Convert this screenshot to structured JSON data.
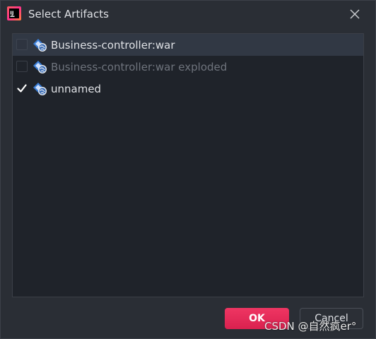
{
  "dialog": {
    "title": "Select Artifacts",
    "icon": "intellij-idea-icon",
    "close_icon": "close-icon"
  },
  "artifacts": [
    {
      "label": "Business-controller:war",
      "checked": false,
      "enabled": true,
      "selected": true,
      "icon": "web-artifact-icon"
    },
    {
      "label": "Business-controller:war exploded",
      "checked": false,
      "enabled": false,
      "selected": false,
      "icon": "web-artifact-icon"
    },
    {
      "label": "unnamed",
      "checked": true,
      "enabled": true,
      "selected": false,
      "icon": "web-artifact-icon"
    }
  ],
  "buttons": {
    "ok_label": "OK",
    "cancel_label": "Cancel"
  },
  "watermark": "CSDN @自然疯er°",
  "colors": {
    "background": "#2a2e35",
    "list_background": "#1f232a",
    "selected_row": "#313844",
    "ok_button": "#e42a57",
    "text": "#dfe1e5",
    "disabled_text": "#6f747d"
  }
}
